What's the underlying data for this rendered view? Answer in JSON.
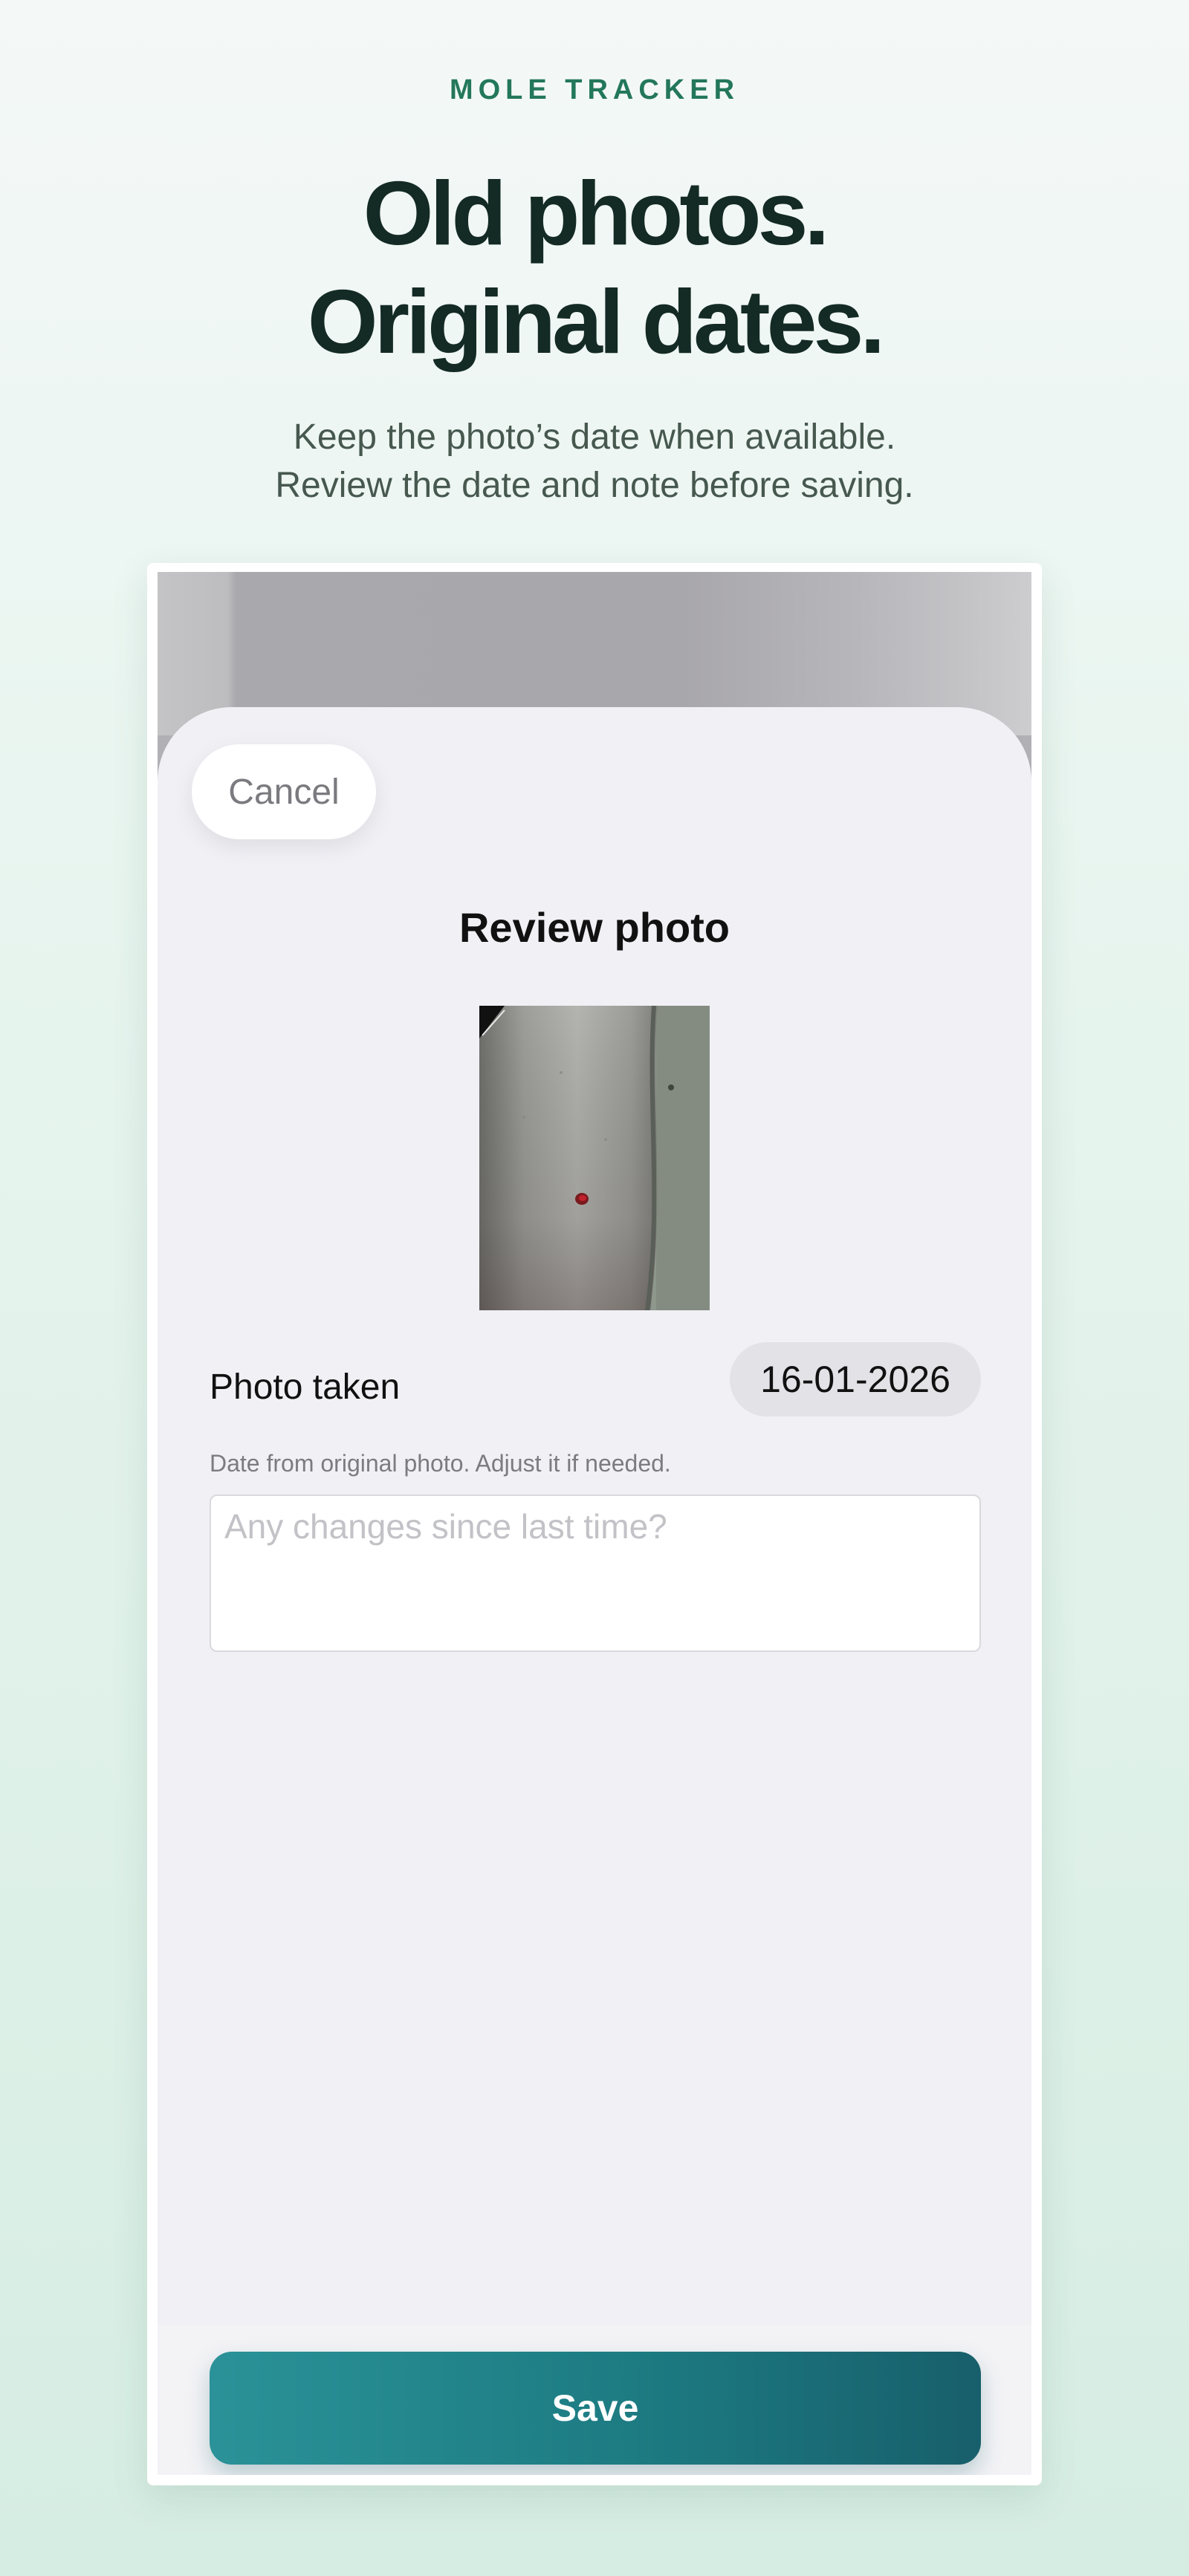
{
  "header": {
    "eyebrow": "MOLE TRACKER",
    "headline_line1": "Old photos.",
    "headline_line2": "Original dates.",
    "subhead_line1": "Keep the photo’s date when available.",
    "subhead_line2": "Review the date and note before saving."
  },
  "review_sheet": {
    "cancel_label": "Cancel",
    "title": "Review photo",
    "photo_taken_label": "Photo taken",
    "photo_date": "16-01-2026",
    "date_hint": "Date from original photo. Adjust it if needed.",
    "note_value": "",
    "note_placeholder": "Any changes since last time?",
    "save_label": "Save"
  },
  "colors": {
    "eyebrow": "#23775a",
    "headline": "#142a24",
    "save_gradient_start": "#2a9298",
    "save_gradient_end": "#175f6b",
    "sheet_background": "#f0f0f5"
  }
}
